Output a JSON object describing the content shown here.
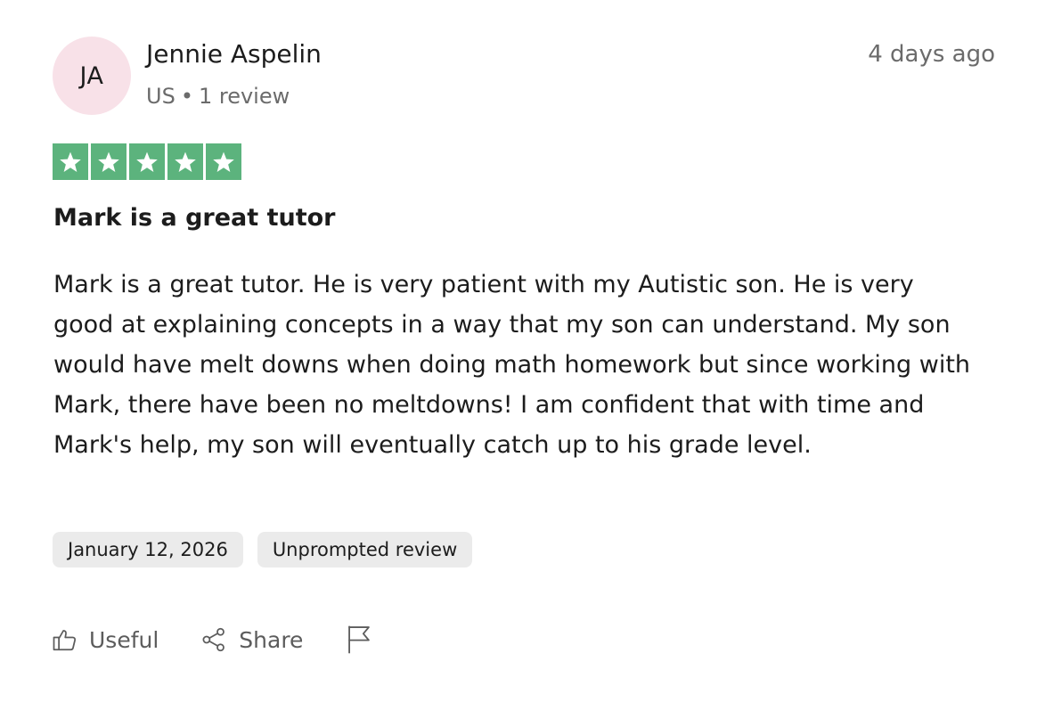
{
  "reviewer": {
    "initials": "JA",
    "name": "Jennie Aspelin",
    "country": "US",
    "separator": "•",
    "review_count": "1 review"
  },
  "review": {
    "time_ago": "4 days ago",
    "rating": 5,
    "rating_max": 5,
    "title": "Mark is a great tutor",
    "body": "Mark is a great tutor. He is very patient with my Autistic son. He is very good at explaining concepts in a way that my son can understand. My son would have melt downs when doing math homework but since working with Mark, there have been no meltdowns! I am confident that with time and Mark's help, my son will eventually catch up to his grade level.",
    "date_tag": "January 12, 2026",
    "type_tag": "Unprompted review"
  },
  "actions": {
    "useful_label": "Useful",
    "share_label": "Share",
    "report_icon": "flag-icon",
    "useful_icon": "thumbs-up-icon",
    "share_icon": "share-icon"
  },
  "colors": {
    "star_green": "#5cb37d",
    "avatar_bg": "#f8e1e8",
    "tag_bg": "#ebebeb",
    "muted_text": "#6b6b6b"
  }
}
